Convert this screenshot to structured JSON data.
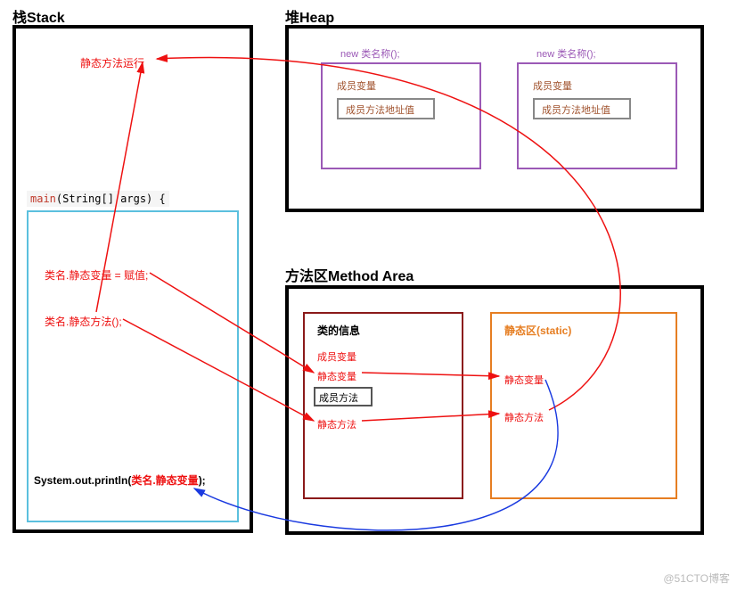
{
  "stack": {
    "title": "栈Stack",
    "static_method_run": "静态方法运行",
    "main_sig": "main(String[] args) {",
    "line_assign": "类名.静态变量 = 赋值;",
    "line_call": "类名.静态方法();",
    "println": "System.out.println(类名.静态变量);"
  },
  "heap": {
    "title": "堆Heap",
    "obj1": {
      "new_label": "new 类名称();",
      "member_var": "成员变量",
      "method_addr": "成员方法地址值"
    },
    "obj2": {
      "new_label": "new 类名称();",
      "member_var": "成员变量",
      "method_addr": "成员方法地址值"
    }
  },
  "method_area": {
    "title": "方法区Method Area",
    "class_info": {
      "title": "类的信息",
      "member_var": "成员变量",
      "static_var": "静态变量",
      "member_method": "成员方法",
      "static_method": "静态方法"
    },
    "static_zone": {
      "title": "静态区(static)",
      "static_var": "静态变量",
      "static_method": "静态方法"
    }
  },
  "watermark": "@51CTO博客"
}
